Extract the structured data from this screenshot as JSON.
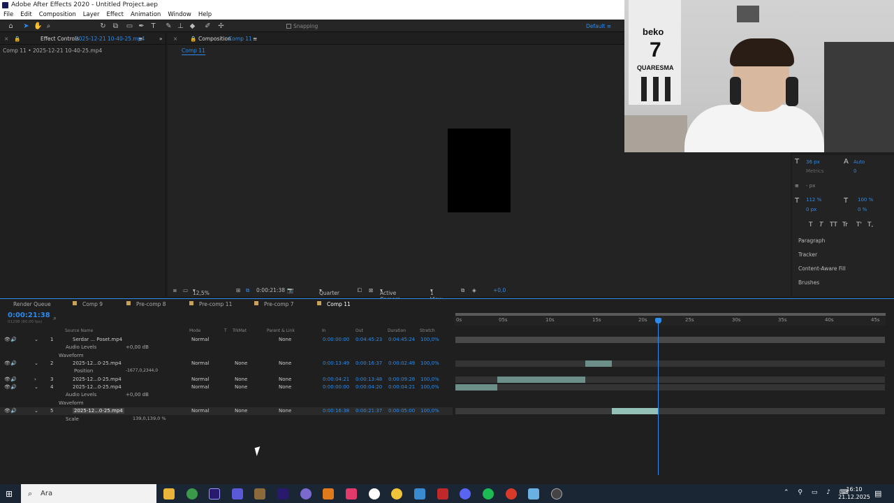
{
  "window": {
    "title": "Adobe After Effects 2020 - Untitled Project.aep"
  },
  "menu": [
    "File",
    "Edit",
    "Composition",
    "Layer",
    "Effect",
    "Animation",
    "Window",
    "Help"
  ],
  "toolbar": {
    "snapping": "Snapping",
    "workspace": "Default"
  },
  "effect_controls": {
    "title": "Effect Controls",
    "file": "2025-12-21 10-40-25.mp4",
    "sub": "Comp 11 • 2025-12-21 10-40-25.mp4"
  },
  "composition": {
    "title": "Composition",
    "name": "Comp 11",
    "tab": "Comp 11"
  },
  "comp_footer": {
    "zoom": "12,5%",
    "time": "0:00:21:38",
    "resolution": "Quarter",
    "camera": "Active Camera",
    "view": "1 View",
    "exposure": "+0,0"
  },
  "character": {
    "size": "36 px",
    "leading": "Auto",
    "metrics": "Metrics",
    "tracking": "0",
    "stroke_unit": "- px",
    "vscale": "112 %",
    "hscale": "100 %",
    "baseline": "0 px",
    "tsume": "0 %",
    "styles": [
      "T",
      "T",
      "TT",
      "Tr",
      "T'",
      "T,"
    ]
  },
  "side_panels": [
    "Paragraph",
    "Tracker",
    "Content-Aware Fill",
    "Brushes"
  ],
  "timeline": {
    "tabs": [
      "Render Queue",
      "Comp 9",
      "Pre-comp 8",
      "Pre-comp 11",
      "Pre-comp 7",
      "Comp 11"
    ],
    "timecode": "0:00:21:38",
    "timecode_sub": "01298 (60.00 fps)",
    "headers": {
      "source": "Source Name",
      "mode": "Mode",
      "t": "T",
      "trkmat": "TrkMat",
      "parent": "Parent & Link",
      "in": "In",
      "out": "Out",
      "duration": "Duration",
      "stretch": "Stretch"
    },
    "ruler": [
      "0s",
      "05s",
      "10s",
      "15s",
      "20s",
      "25s",
      "30s",
      "35s",
      "40s",
      "45s"
    ],
    "layers": [
      {
        "num": "1",
        "name": "Serdar ... Poset.mp4",
        "mode": "Normal",
        "trkmat": "",
        "parent": "None",
        "in": "0:00:00:00",
        "out": "0:04:45:23",
        "dur": "0:04:45:24",
        "stretch": "100,0%"
      },
      {
        "num": "2",
        "name": "2025-12...0-25.mp4",
        "mode": "Normal",
        "trkmat": "None",
        "parent": "None",
        "in": "0:00:13:49",
        "out": "0:00:16:37",
        "dur": "0:00:02:49",
        "stretch": "100,0%"
      },
      {
        "num": "3",
        "name": "2025-12...0-25.mp4",
        "mode": "Normal",
        "trkmat": "None",
        "parent": "None",
        "in": "0:00:04:21",
        "out": "0:00:13:48",
        "dur": "0:00:09:28",
        "stretch": "100,0%"
      },
      {
        "num": "4",
        "name": "2025-12...0-25.mp4",
        "mode": "Normal",
        "trkmat": "None",
        "parent": "None",
        "in": "0:00:00:00",
        "out": "0:00:04:20",
        "dur": "0:00:04:21",
        "stretch": "100,0%"
      },
      {
        "num": "5",
        "name": "2025-12...0-25.mp4",
        "mode": "Normal",
        "trkmat": "None",
        "parent": "None",
        "in": "0:00:16:38",
        "out": "0:00:21:37",
        "dur": "0:00:05:00",
        "stretch": "100,0%"
      }
    ],
    "props": {
      "audio_levels": "Audio Levels",
      "audio_value": "+0,00 dB",
      "waveform": "Waveform",
      "position": "Position",
      "position_value": "-1677,0,2344,0",
      "scale": "Scale",
      "scale_value": "139,0,139,0 %"
    }
  },
  "webcam": {
    "jersey_brand": "beko",
    "jersey_number": "7",
    "jersey_name": "QUARESMA"
  },
  "taskbar": {
    "search": "Ara",
    "time": "16:10",
    "date": "21.12.2025"
  },
  "colors": {
    "accent": "#2d8ceb",
    "panel": "#1f1f1f"
  }
}
